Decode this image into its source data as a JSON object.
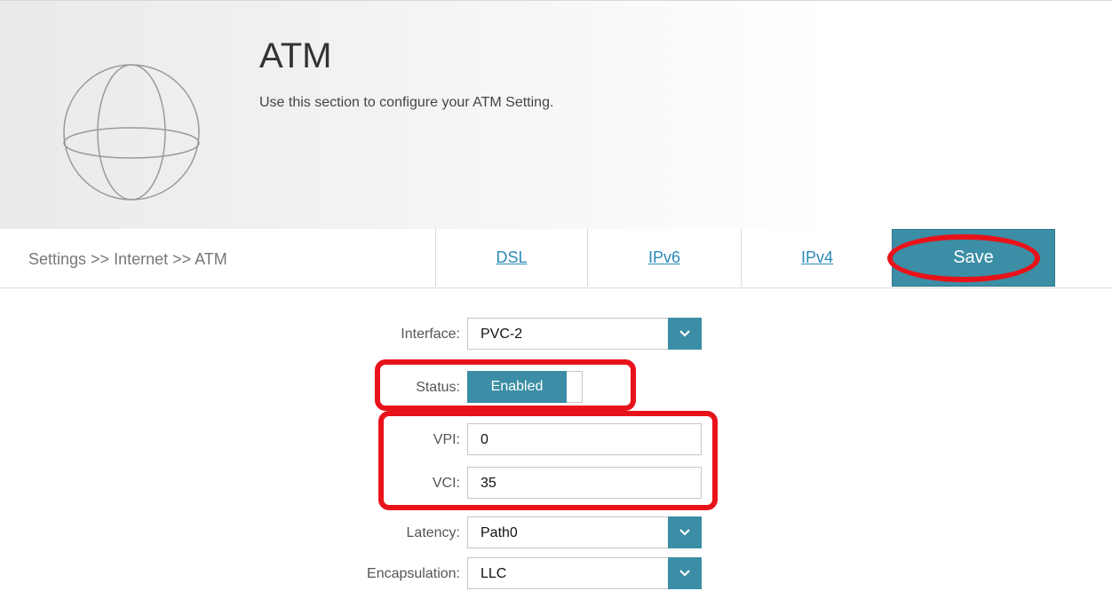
{
  "page": {
    "title": "ATM",
    "subtitle": "Use this section to configure your ATM Setting."
  },
  "nav": {
    "breadcrumb": "Settings >> Internet >> ATM",
    "tabs": [
      {
        "label": "DSL"
      },
      {
        "label": "IPv6"
      },
      {
        "label": "IPv4"
      }
    ],
    "save_label": "Save"
  },
  "form": {
    "interface": {
      "label": "Interface:",
      "value": "PVC-2"
    },
    "status": {
      "label": "Status:",
      "value": "Enabled"
    },
    "vpi": {
      "label": "VPI:",
      "value": "0"
    },
    "vci": {
      "label": "VCI:",
      "value": "35"
    },
    "latency": {
      "label": "Latency:",
      "value": "Path0"
    },
    "encapsulation": {
      "label": "Encapsulation:",
      "value": "LLC"
    }
  },
  "colors": {
    "accent": "#3b8ea5",
    "highlight": "#e8131a",
    "link": "#2a8ab8"
  },
  "icons": [
    "globe-icon",
    "chevron-down-icon"
  ]
}
